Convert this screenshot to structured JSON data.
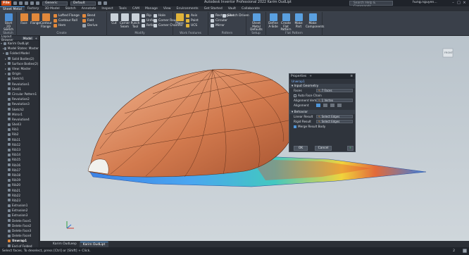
{
  "titlebar": {
    "file": "File",
    "material": "Generic",
    "appearance": "Default",
    "title": "Autodesk Inventor Professional 2022   Karim OudLipt",
    "search_placeholder": "Search Help & Commands...",
    "user": "hung.nguyen..."
  },
  "tabs": [
    "Sheet Metal",
    "Factory",
    "3D Model",
    "Sketch",
    "Annotate",
    "Inspect",
    "Tools",
    "CAM",
    "Manage",
    "View",
    "Environments",
    "Get Started",
    "Vault",
    "Collaborate"
  ],
  "ribbon": {
    "sketch": {
      "start": "Start 2D Sketch",
      "label": "Sketch"
    },
    "create": {
      "face": "Face",
      "flange": "Flange",
      "contour": "Contour Flange",
      "lofted": "Lofted Flange",
      "roll": "Contour Roll",
      "hem": "Hem",
      "bend": "Bend",
      "fold": "Fold",
      "derive": "Derive",
      "label": "Create"
    },
    "modify": {
      "cut": "Cut",
      "corner": "Corner Seam",
      "punch": "Punch Tool",
      "rip": "Rip",
      "unfold": "Unfold",
      "refold": "Refold",
      "hole": "Hole",
      "round": "Corner Round",
      "chamfer": "Corner Chamfer",
      "label": "Modify"
    },
    "work": {
      "plane": "Plane",
      "axis": "Axis",
      "point": "Point",
      "ucs": "UCS",
      "label": "Work Features"
    },
    "pattern": {
      "rect": "Rectangular",
      "circ": "Circular",
      "mirror": "Mirror",
      "label": "Pattern"
    },
    "sketch_driven": "Sketch Driven",
    "setup": {
      "defaults": "Sheet Metal Defaults",
      "label": "Setup"
    },
    "flat": {
      "aside": "Define A-Side",
      "create": "Create Flat Pattern",
      "make": "Make Part",
      "components": "Make Components",
      "label": "Flat Pattern"
    }
  },
  "browser": {
    "tabs": [
      "Layout Browser",
      "Model",
      "+"
    ],
    "items": [
      {
        "label": "Karim OudLipt",
        "hl": false,
        "exp": "▾",
        "lvl": 0
      },
      {
        "label": "Model States: Master",
        "hl": false,
        "exp": "▸",
        "lvl": 1
      },
      {
        "label": "Folded Model",
        "hl": false,
        "exp": "▾",
        "lvl": 1
      },
      {
        "label": "Solid Bodies(2)",
        "hl": false,
        "exp": "▸",
        "lvl": 2
      },
      {
        "label": "Surface Bodies(2)",
        "hl": false,
        "exp": "▸",
        "lvl": 2
      },
      {
        "label": "View: Master",
        "hl": false,
        "exp": "▸",
        "lvl": 2
      },
      {
        "label": "Origin",
        "hl": false,
        "exp": "▸",
        "lvl": 2
      },
      {
        "label": "Sketch1",
        "hl": false,
        "exp": "",
        "lvl": 2
      },
      {
        "label": "Revolution1",
        "hl": false,
        "exp": "",
        "lvl": 2
      },
      {
        "label": "Shell1",
        "hl": false,
        "exp": "",
        "lvl": 2
      },
      {
        "label": "Circular Pattern1",
        "hl": false,
        "exp": "",
        "lvl": 2
      },
      {
        "label": "Revolution2",
        "hl": false,
        "exp": "",
        "lvl": 2
      },
      {
        "label": "Revolution3",
        "hl": false,
        "exp": "",
        "lvl": 2
      },
      {
        "label": "Sketch2",
        "hl": false,
        "exp": "",
        "lvl": 2
      },
      {
        "label": "Mirror1",
        "hl": false,
        "exp": "",
        "lvl": 2
      },
      {
        "label": "Revolution4",
        "hl": false,
        "exp": "",
        "lvl": 2
      },
      {
        "label": "Shell3",
        "hl": false,
        "exp": "",
        "lvl": 2
      },
      {
        "label": "Rib1",
        "hl": false,
        "exp": "",
        "lvl": 2
      },
      {
        "label": "Rib2",
        "hl": false,
        "exp": "",
        "lvl": 2
      },
      {
        "label": "Rib11",
        "hl": false,
        "exp": "",
        "lvl": 2
      },
      {
        "label": "Rib12",
        "hl": false,
        "exp": "",
        "lvl": 2
      },
      {
        "label": "Rib13",
        "hl": false,
        "exp": "",
        "lvl": 2
      },
      {
        "label": "Rib14",
        "hl": false,
        "exp": "",
        "lvl": 2
      },
      {
        "label": "Rib15",
        "hl": false,
        "exp": "",
        "lvl": 2
      },
      {
        "label": "Rib16",
        "hl": false,
        "exp": "",
        "lvl": 2
      },
      {
        "label": "Rib17",
        "hl": false,
        "exp": "",
        "lvl": 2
      },
      {
        "label": "Rib18",
        "hl": false,
        "exp": "",
        "lvl": 2
      },
      {
        "label": "Rib19",
        "hl": false,
        "exp": "",
        "lvl": 2
      },
      {
        "label": "Rib20",
        "hl": false,
        "exp": "",
        "lvl": 2
      },
      {
        "label": "Rib21",
        "hl": false,
        "exp": "",
        "lvl": 2
      },
      {
        "label": "Rib22",
        "hl": false,
        "exp": "",
        "lvl": 2
      },
      {
        "label": "Rib23",
        "hl": false,
        "exp": "",
        "lvl": 2
      },
      {
        "label": "Extrusion1",
        "hl": false,
        "exp": "",
        "lvl": 2
      },
      {
        "label": "Extrusion2",
        "hl": false,
        "exp": "",
        "lvl": 2
      },
      {
        "label": "Extrusion3",
        "hl": false,
        "exp": "",
        "lvl": 2
      },
      {
        "label": "Delete Face1",
        "hl": false,
        "exp": "",
        "lvl": 2
      },
      {
        "label": "Delete Face2",
        "hl": false,
        "exp": "",
        "lvl": 2
      },
      {
        "label": "Delete Face3",
        "hl": false,
        "exp": "",
        "lvl": 2
      },
      {
        "label": "Delete Face4",
        "hl": false,
        "exp": "",
        "lvl": 2
      },
      {
        "label": "Unwrap1",
        "hl": true,
        "exp": "",
        "lvl": 2
      },
      {
        "label": "End of Folded",
        "hl": false,
        "exp": "",
        "lvl": 2
      }
    ]
  },
  "props": {
    "tabs": [
      "Properties",
      "+"
    ],
    "feature": "Unwrap1",
    "input_geometry": "Input Geometry",
    "faces_label": "Faces",
    "faces_value": "7 Faces",
    "auto_chain": "Auto Face Chain",
    "align_vertex_label": "Alignment Vertex",
    "align_vertex_value": "1 Vertex",
    "alignment_label": "Alignment",
    "behavior": "Behavior",
    "linear_label": "Linear Result",
    "linear_value": "Select Edges",
    "rigid_label": "Rigid Result",
    "rigid_value": "Select Edges",
    "merge_label": "Merge Result Body",
    "ok": "OK",
    "cancel": "Cancel",
    "add": "+"
  },
  "doc_tabs": [
    "Karim OudLeep",
    "Karim OudLipt"
  ],
  "status": "Select faces. To deselect, press [Ctrl] or [Shift] + Click.",
  "status_count": "2"
}
